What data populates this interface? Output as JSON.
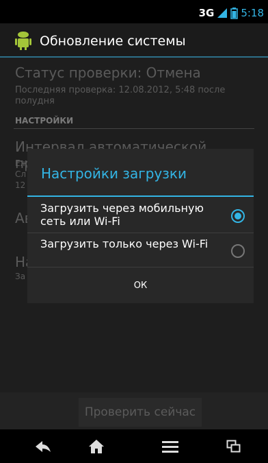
{
  "status_bar": {
    "network": "3G",
    "time": "5:18"
  },
  "app": {
    "title": "Обновление системы"
  },
  "content": {
    "status_line": "Статус проверки: Отмена",
    "last_check": "Последняя проверка: 12.08.2012, 5:48 после полудня",
    "section_header": "НАСТРОЙКИ",
    "pref1_title": "Интервал автоматической проверки",
    "pref1_sub1": "Еж",
    "pref1_sub2": "Сл",
    "pref1_sub3": "12",
    "pref2_title": "Ав",
    "pref3_title": "На",
    "pref3_sub": "За"
  },
  "dialog": {
    "title": "Настройки загрузки",
    "options": [
      {
        "label": "Загрузить через мобильную сеть или Wi-Fi",
        "selected": true
      },
      {
        "label": "Загрузить только через Wi-Fi",
        "selected": false
      }
    ],
    "ok_label": "ОК"
  },
  "bottom": {
    "check_now": "Проверить сейчас"
  },
  "colors": {
    "accent": "#33b5e5",
    "android_green": "#a4c639"
  }
}
